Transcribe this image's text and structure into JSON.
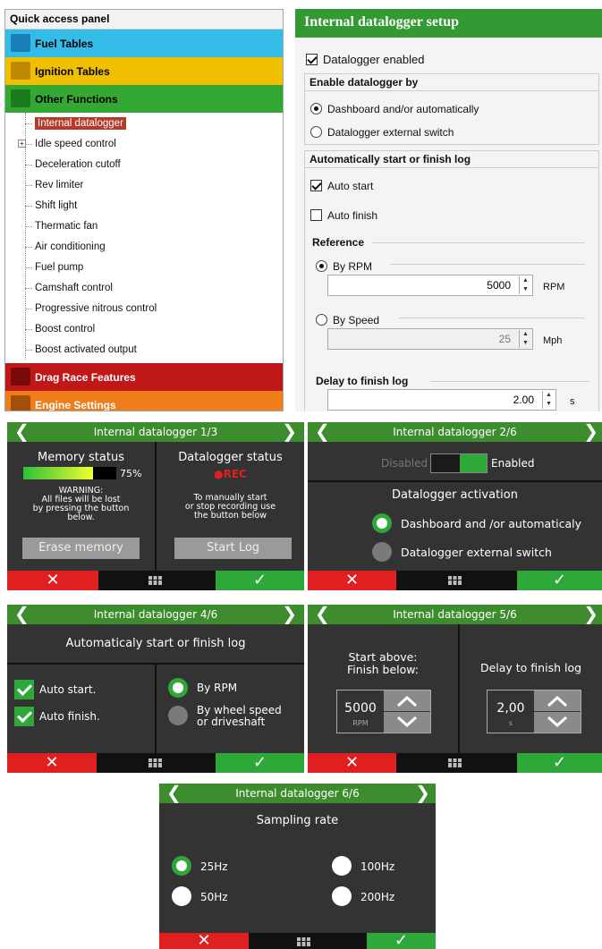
{
  "desktop": {
    "quick_access": {
      "title": "Quick access panel",
      "categories": [
        {
          "label": "Fuel Tables",
          "color": "#33bce8"
        },
        {
          "label": "Ignition Tables",
          "color": "#f0c000"
        },
        {
          "label": "Other Functions",
          "color": "#33a933"
        },
        {
          "label": "Drag Race Features",
          "color": "#c01818"
        },
        {
          "label": "Engine Settings",
          "color": "#ef7d1a"
        }
      ],
      "tree_items": [
        "Internal datalogger",
        "Idle speed control",
        "Deceleration cutoff",
        "Rev limiter",
        "Shift light",
        "Thermatic fan",
        "Air conditioning",
        "Fuel pump",
        "Camshaft control",
        "Progressive nitrous control",
        "Boost control",
        "Boost activated output"
      ],
      "expand_symbol": "+"
    },
    "setup": {
      "title": "Internal datalogger setup",
      "datalogger_enabled": "Datalogger enabled",
      "enable_by": {
        "title": "Enable datalogger by",
        "opt1": "Dashboard and/or automatically",
        "opt2": "Datalogger external switch"
      },
      "auto": {
        "title": "Automatically start or finish log",
        "auto_start": "Auto start",
        "auto_finish": "Auto finish",
        "reference": "Reference",
        "by_rpm": "By RPM",
        "rpm_value": "5000",
        "rpm_unit": "RPM",
        "by_speed": "By Speed",
        "speed_value": "25",
        "speed_unit": "Mph",
        "delay_label": "Delay to finish log",
        "delay_value": "2.00",
        "delay_unit": "s"
      }
    }
  },
  "screens": {
    "s1": {
      "title": "Internal datalogger 1/3",
      "memory_status": "Memory status",
      "memory_percent_text": "75%",
      "memory_fill": 0.75,
      "warning": "WARNING:\nAll files will be lost\nby pressing the button\nbelow.",
      "erase": "Erase memory",
      "datalogger_status": "Datalogger status",
      "rec": "●REC",
      "manual_note": "To manually start\nor stop recording use\nthe button below",
      "start_log": "Start Log"
    },
    "s2": {
      "title": "Internal datalogger 2/6",
      "disabled": "Disabled",
      "enabled": "Enabled",
      "activation": "Datalogger activation",
      "opt1": "Dashboard and /or automaticaly",
      "opt2": "Datalogger external switch"
    },
    "s4": {
      "title": "Internal datalogger 4/6",
      "subtitle": "Automaticaly start or finish log",
      "auto_start": "Auto start.",
      "auto_finish": "Auto finish.",
      "by_rpm": "By RPM",
      "by_speed": "By wheel speed\nor driveshaft"
    },
    "s5": {
      "title": "Internal datalogger 5/6",
      "start_above": "Start above:\nFinish below:",
      "rpm_value": "5000",
      "rpm_unit": "RPM",
      "delay_label": "Delay to finish log",
      "delay_value": "2,00",
      "delay_unit": "s"
    },
    "s6": {
      "title": "Internal datalogger 6/6",
      "subtitle": "Sampling rate",
      "r25": "25Hz",
      "r50": "50Hz",
      "r100": "100Hz",
      "r200": "200Hz"
    },
    "nav": {
      "left": "❮",
      "right": "❯",
      "cancel": "✕",
      "confirm": "✓"
    }
  }
}
